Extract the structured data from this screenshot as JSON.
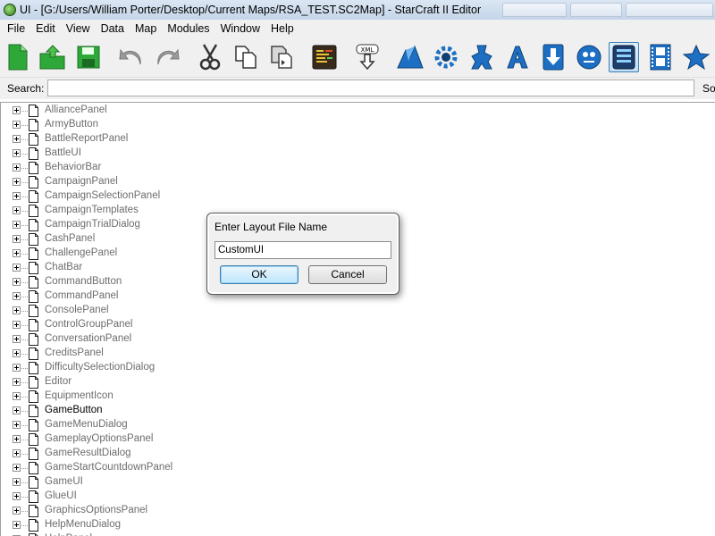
{
  "window": {
    "title": "UI - [G:/Users/William Porter/Desktop/Current Maps/RSA_TEST.SC2Map] - StarCraft II Editor"
  },
  "menu": [
    "File",
    "Edit",
    "View",
    "Data",
    "Map",
    "Modules",
    "Window",
    "Help"
  ],
  "toolbar": {
    "buttons": [
      {
        "icon": "new-document-icon"
      },
      {
        "icon": "open-folder-icon"
      },
      {
        "icon": "save-disk-icon"
      },
      {
        "icon": "undo-icon"
      },
      {
        "icon": "redo-icon"
      },
      {
        "icon": "cut-scissors-icon"
      },
      {
        "icon": "copy-icon"
      },
      {
        "icon": "paste-icon"
      },
      {
        "icon": "script-editor-icon"
      },
      {
        "icon": "xml-download-icon"
      },
      {
        "icon": "terrain-icon"
      },
      {
        "icon": "triggers-icon"
      },
      {
        "icon": "data-editor-icon"
      },
      {
        "icon": "text-editor-icon"
      },
      {
        "icon": "import-icon"
      },
      {
        "icon": "ai-editor-icon"
      },
      {
        "icon": "ui-editor-icon"
      },
      {
        "icon": "cutscene-icon"
      },
      {
        "icon": "modules-icon"
      }
    ],
    "selected_icon": "ui-editor-icon"
  },
  "search": {
    "label": "Search:",
    "value": "",
    "sort_label": "Sor"
  },
  "tree": {
    "items": [
      "AlliancePanel",
      "ArmyButton",
      "BattleReportPanel",
      "BattleUI",
      "BehaviorBar",
      "CampaignPanel",
      "CampaignSelectionPanel",
      "CampaignTemplates",
      "CampaignTrialDialog",
      "CashPanel",
      "ChallengePanel",
      "ChatBar",
      "CommandButton",
      "CommandPanel",
      "ConsolePanel",
      "ControlGroupPanel",
      "ConversationPanel",
      "CreditsPanel",
      "DifficultySelectionDialog",
      "Editor",
      "EquipmentIcon",
      "GameButton",
      "GameMenuDialog",
      "GameplayOptionsPanel",
      "GameResultDialog",
      "GameStartCountdownPanel",
      "GameUI",
      "GlueUI",
      "GraphicsOptionsPanel",
      "HelpMenuDialog",
      "HelpPanel"
    ],
    "selected": "GameButton"
  },
  "dialog": {
    "title": "Enter Layout File Name",
    "input_value": "CustomUI",
    "ok_label": "OK",
    "cancel_label": "Cancel"
  },
  "colors": {
    "titlebar": "#c5d5e8",
    "chrome": "#f0f0f0",
    "tree_text": "#6d6d6d",
    "selection_accent": "#3c7fb1"
  }
}
